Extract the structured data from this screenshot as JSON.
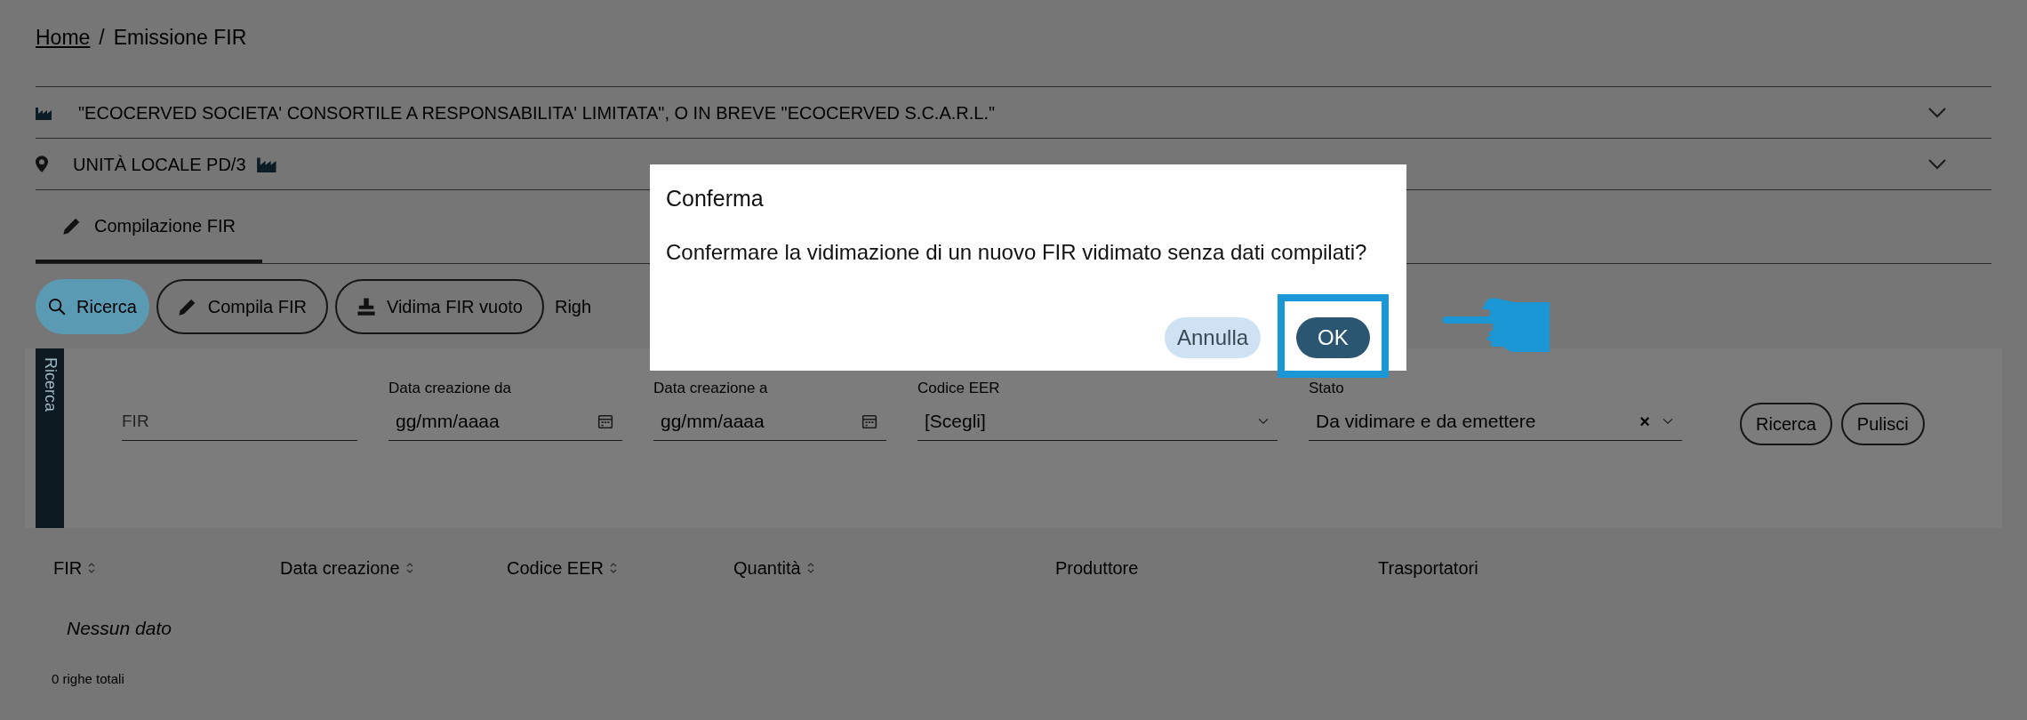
{
  "breadcrumb": {
    "home": "Home",
    "separator": "/",
    "current": "Emissione FIR"
  },
  "context_rows": [
    {
      "kind": "company",
      "label": "\"ECOCERVED SOCIETA' CONSORTILE A RESPONSABILITA' LIMITATA\", O IN BREVE \"ECOCERVED S.C.A.R.L.\""
    },
    {
      "kind": "unit",
      "label": "UNITÀ LOCALE PD/3"
    }
  ],
  "tabs": [
    {
      "label": "Compilazione FIR",
      "selected": true
    }
  ],
  "toolbar": {
    "buttons": [
      {
        "label": "Ricerca",
        "kind": "search",
        "selected": true
      },
      {
        "label": "Compila FIR",
        "kind": "edit",
        "selected": false
      },
      {
        "label": "Vidima FIR vuoto",
        "kind": "stamp",
        "selected": false
      }
    ],
    "trailing_text": "Righ"
  },
  "search_panel": {
    "side_tab": "Ricerca",
    "fields": [
      {
        "kind": "text",
        "placeholder": "FIR"
      },
      {
        "kind": "date",
        "label": "Data creazione da",
        "placeholder": "gg/mm/aaaa"
      },
      {
        "kind": "date",
        "label": "Data creazione a",
        "placeholder": "gg/mm/aaaa"
      },
      {
        "kind": "select",
        "label": "Codice EER",
        "value": "[Scegli]"
      },
      {
        "kind": "select",
        "label": "Stato",
        "value": "Da vidimare e da emettere",
        "clear_symbol": "×"
      }
    ],
    "buttons": [
      "Ricerca",
      "Pulisci"
    ]
  },
  "table": {
    "columns": [
      {
        "label": "FIR",
        "sortable": true
      },
      {
        "label": "Data creazione",
        "sortable": true
      },
      {
        "label": "Codice EER",
        "sortable": true
      },
      {
        "label": "Quantità",
        "sortable": true
      },
      {
        "label": "Produttore",
        "sortable": false
      },
      {
        "label": "Trasportatori",
        "sortable": false
      }
    ],
    "empty_text": "Nessun dato",
    "footer": "0 righe totali"
  },
  "dialog": {
    "title": "Conferma",
    "message": "Confermare la vidimazione di un nuovo FIR vidimato senza dati compilati?",
    "buttons": [
      {
        "label": "Annulla",
        "kind": "secondary",
        "highlighted": false
      },
      {
        "label": "OK",
        "kind": "primary",
        "highlighted": true
      }
    ]
  }
}
